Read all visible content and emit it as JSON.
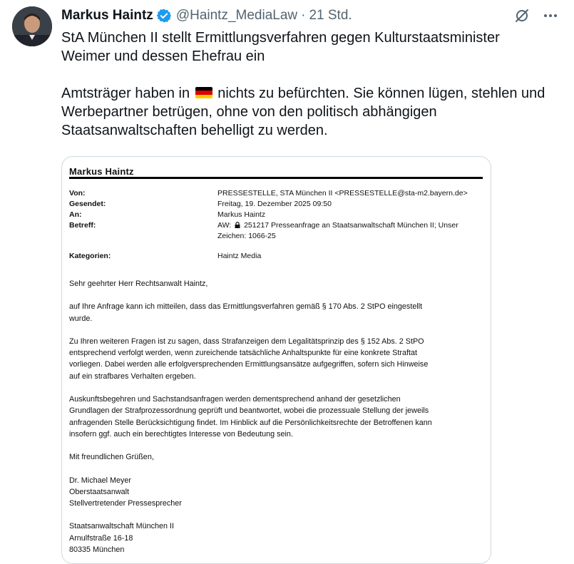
{
  "tweet": {
    "author_name": "Markus Haintz",
    "handle": "@Haintz_MediaLaw",
    "separator": "·",
    "time": "21 Std.",
    "text_line1": "StA München II stellt Ermittlungsverfahren gegen Kulturstaatsminister",
    "text_line2": "Weimer und dessen Ehefrau ein",
    "text_p2_before_flag": "Amtsträger haben in ",
    "text_p2_after_flag": " nichts zu befürchten. Sie können lügen, stehlen und",
    "text_p2_line2": "Werbepartner betrügen, ohne von den politisch abhängigen",
    "text_p2_line3": "Staatsanwaltschaften behelligt zu werden.",
    "flag_colors": [
      "#000000",
      "#dd0000",
      "#ffce00"
    ],
    "verified_color": "#1d9bf0"
  },
  "header_icons": [
    "grok-icon",
    "more-icon"
  ],
  "email": {
    "header_name": "Markus  Haintz",
    "fields": [
      {
        "label": "Von:",
        "value": "PRESSESTELLE, STA München II <PRESSESTELLE@sta-m2.bayern.de>"
      },
      {
        "label": "Gesendet:",
        "value": "Freitag, 19. Dezember 2025 09:50"
      },
      {
        "label": "An:",
        "value": "Markus  Haintz"
      },
      {
        "label": "Betreff:",
        "value_prefix": "AW: ",
        "value": " 251217 Presseanfrage an Staatsanwaltschaft München II; Unser",
        "value_line2": "Zeichen: 1066-25"
      },
      {
        "label": "Kategorien:",
        "value": "Haintz Media"
      }
    ],
    "salutation": "Sehr geehrter Herr Rechtsanwalt Haintz,",
    "p1_l1": "auf Ihre Anfrage kann ich mitteilen, dass das Ermittlungsverfahren gemäß § 170 Abs. 2 StPO eingestellt",
    "p1_l2": "wurde.",
    "p2_l1": "Zu Ihren weiteren Fragen ist zu sagen, dass Strafanzeigen dem Legalitätsprinzip des § 152 Abs. 2 StPO",
    "p2_l2": "entsprechend verfolgt werden, wenn zureichende tatsächliche Anhaltspunkte für eine konkrete Straftat",
    "p2_l3": "vorliegen. Dabei werden alle erfolgversprechenden Ermittlungsansätze aufgegriffen, sofern sich Hinweise",
    "p2_l4": "auf ein strafbares Verhalten ergeben.",
    "p3_l1": "Auskunftsbegehren und Sachstandsanfragen werden dementsprechend anhand der gesetzlichen",
    "p3_l2": "Grundlagen der Strafprozessordnung geprüft und beantwortet, wobei die prozessuale Stellung der jeweils",
    "p3_l3": "anfragenden Stelle Berücksichtigung findet. Im Hinblick auf die Persönlichkeitsrechte der Betroffenen kann",
    "p3_l4": "insofern ggf. auch ein berechtigtes Interesse von Bedeutung sein.",
    "closing": "Mit freundlichen Grüßen,",
    "sig_name": "Dr. Michael Meyer",
    "sig_title1": "Oberstaatsanwalt",
    "sig_title2": "Stellvertretender Pressesprecher",
    "addr1": "Staatsanwaltschaft München II",
    "addr2": "Arnulfstraße 16-18",
    "addr3": "80335 München"
  }
}
